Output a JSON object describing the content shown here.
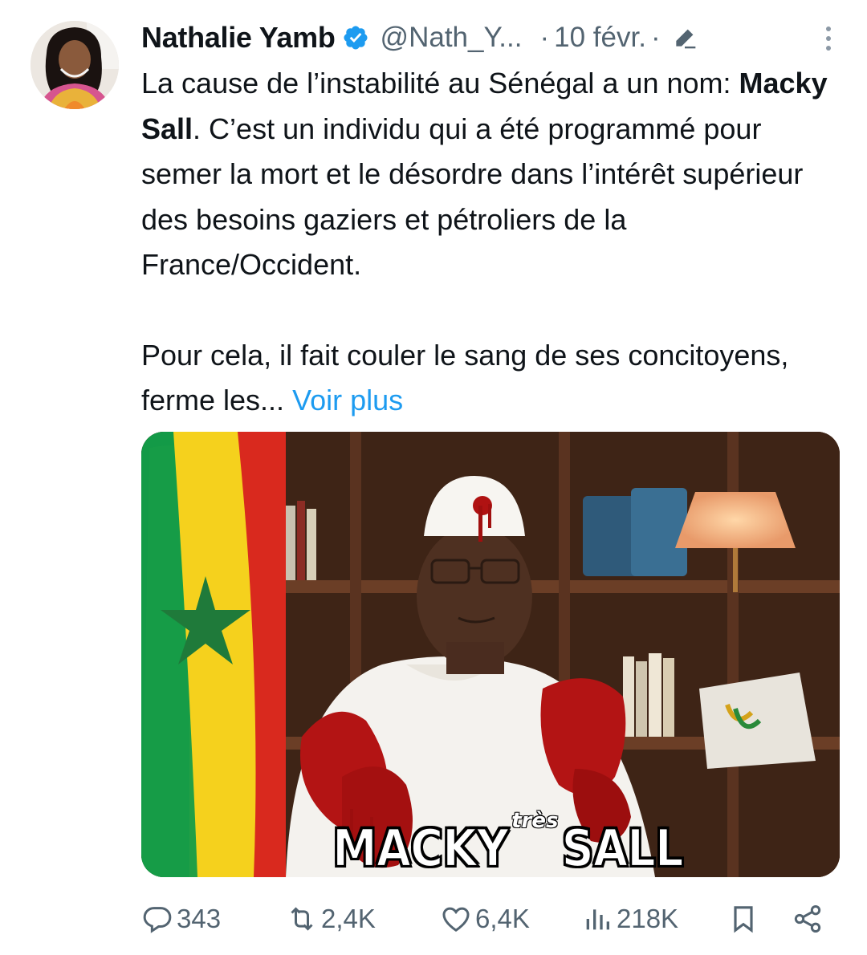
{
  "author": {
    "name": "Nathalie Yamb",
    "handle": "@Nath_Y...",
    "dot": "·",
    "date": "10 févr.",
    "dot2": "·"
  },
  "tweet": {
    "p1_a": "La cause de l’instabilité au Sénégal a un nom: ",
    "p1_bold": "Macky Sall",
    "p1_b": ". C’est un individu qui a été programmé pour semer la mort et le désordre dans l’intérêt supérieur des besoins gaziers et pétroliers de la France/Occident.",
    "p2": "Pour cela, il fait couler le sang de ses concitoyens, ferme les... ",
    "more_link": "Voir plus"
  },
  "media": {
    "caption_left": "MACKY",
    "caption_mid": "très",
    "caption_right": "SALL"
  },
  "actions": {
    "replies": "343",
    "reposts": "2,4K",
    "likes": "6,4K",
    "views": "218K"
  },
  "colors": {
    "text": "#0f1419",
    "secondary": "#536471",
    "link": "#1d9bf0",
    "verified": "#1d9bf0"
  }
}
